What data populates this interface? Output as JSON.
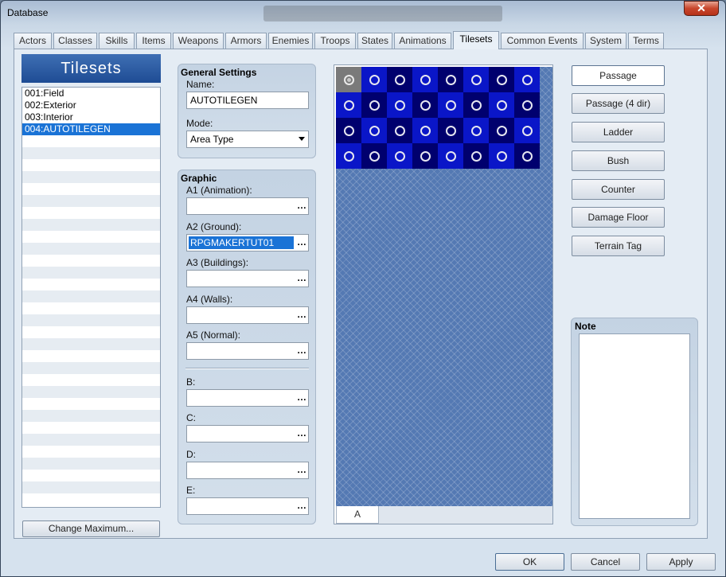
{
  "window": {
    "title": "Database",
    "close_glyph": "✕"
  },
  "tabs": [
    "Actors",
    "Classes",
    "Skills",
    "Items",
    "Weapons",
    "Armors",
    "Enemies",
    "Troops",
    "States",
    "Animations",
    "Tilesets",
    "Common Events",
    "System",
    "Terms"
  ],
  "active_tab": "Tilesets",
  "list": {
    "header": "Tilesets",
    "items": [
      "001:Field",
      "002:Exterior",
      "003:Interior",
      "004:AUTOTILEGEN"
    ],
    "selected_index": 3,
    "change_max_label": "Change Maximum..."
  },
  "general": {
    "header": "General Settings",
    "name_label": "Name:",
    "name_value": "AUTOTILEGEN",
    "mode_label": "Mode:",
    "mode_value": "Area Type"
  },
  "graphic": {
    "header": "Graphic",
    "fields": [
      {
        "label": "A1 (Animation):",
        "value": ""
      },
      {
        "label": "A2 (Ground):",
        "value": "RPGMAKERTUT01"
      },
      {
        "label": "A3 (Buildings):",
        "value": ""
      },
      {
        "label": "A4 (Walls):",
        "value": ""
      },
      {
        "label": "A5 (Normal):",
        "value": ""
      },
      {
        "label": "B:",
        "value": ""
      },
      {
        "label": "C:",
        "value": ""
      },
      {
        "label": "D:",
        "value": ""
      },
      {
        "label": "E:",
        "value": ""
      }
    ],
    "browse_glyph": "…"
  },
  "tileset_view": {
    "tab_label": "A",
    "columns": 8,
    "rows": 4
  },
  "passage_buttons": [
    "Passage",
    "Passage (4 dir)",
    "Ladder",
    "Bush",
    "Counter",
    "Damage Floor",
    "Terrain Tag"
  ],
  "note": {
    "header": "Note",
    "value": ""
  },
  "footer": {
    "ok": "OK",
    "cancel": "Cancel",
    "apply": "Apply"
  },
  "colors": {
    "accent": "#1a73d6",
    "header_blue": "#2a5ba3",
    "tile_dark": "#00006e",
    "tile_light": "#0a16c8"
  }
}
